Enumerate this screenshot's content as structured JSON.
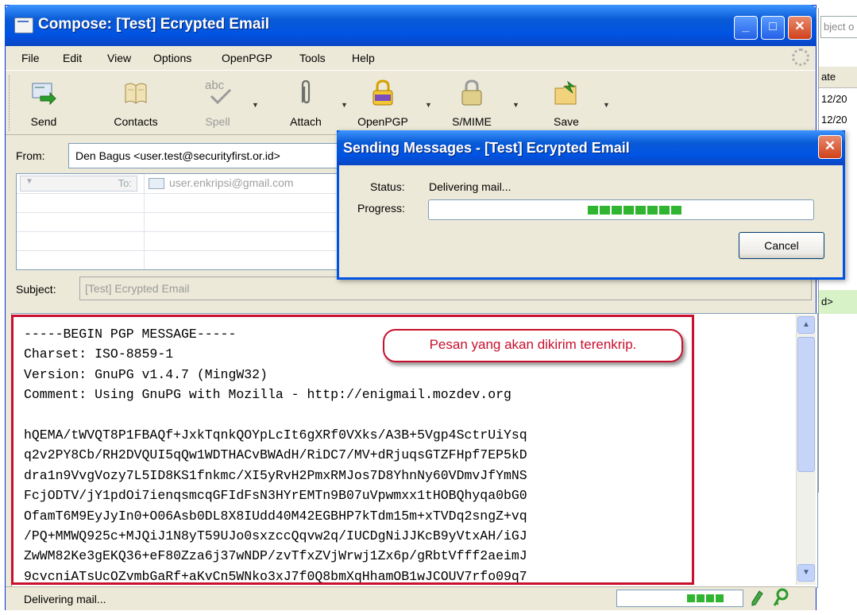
{
  "background_window": {
    "search_placeholder": "bject o",
    "column_header": "ate",
    "rows": [
      "12/20",
      "12/20"
    ],
    "highlight_row_text": "d>"
  },
  "window": {
    "title": "Compose: [Test] Ecrypted Email",
    "minimize_glyph": "_",
    "maximize_glyph": "□",
    "close_glyph": "✕"
  },
  "menu": [
    "File",
    "Edit",
    "View",
    "Options",
    "OpenPGP",
    "Tools",
    "Help"
  ],
  "toolbar": {
    "send": "Send",
    "contacts": "Contacts",
    "spell": "Spell",
    "attach": "Attach",
    "openpgp": "OpenPGP",
    "smime": "S/MIME",
    "save": "Save",
    "spell_icon_text": "abc"
  },
  "compose": {
    "from_label": "From:",
    "from_value": "Den Bagus <user.test@securityfirst.or.id>",
    "to_label": "To:",
    "to_value": "user.enkripsi@gmail.com",
    "subject_label": "Subject:",
    "subject_value": "[Test] Ecrypted Email"
  },
  "body": {
    "lines": [
      "-----BEGIN PGP MESSAGE-----",
      "Charset: ISO-8859-1",
      "Version: GnuPG v1.4.7 (MingW32)",
      "Comment: Using GnuPG with Mozilla - http://enigmail.mozdev.org",
      "",
      "hQEMA/tWVQT8P1FBAQf+JxkTqnkQOYpLcIt6gXRf0VXks/A3B+5Vgp4SctrUiYsq",
      "q2v2PY8Cb/RH2DVQUI5qQw1WDTHACvBWAdH/RiDC7/MV+dRjuqsGTZFHpf7EP5kD",
      "dra1n9VvgVozy7L5ID8KS1fnkmc/XI5yRvH2PmxRMJos7D8YhnNy60VDmvJfYmNS",
      "FcjODTV/jY1pdOi7ienqsmcqGFIdFsN3HYrEMTn9B07uVpwmxx1tHOBQhyqa0bG0",
      "OfamT6M9EyJyIn0+O06Asb0DL8X8IUdd40M42EGBHP7kTdm15m+xTVDq2sngZ+vq",
      "/PQ+MMWQ925c+MJQiJ1N8yT59UJo0sxzccQqvw2q/IUCDgNiJJKcB9yVtxAH/iGJ",
      "ZwWM82Ke3gEKQ36+eF80Zza6j37wNDP/zvTfxZVjWrwj1Zx6p/gRbtVfff2aeimJ",
      "9cvcniATsUcOZvmbGaRf+aKvCn5WNko3xJ7f0Q8bmXqHhamOB1wJCOUV7rfo09q7"
    ],
    "callout": "Pesan yang akan dikirim terenkrip."
  },
  "status_bar": {
    "text": "Delivering mail...",
    "progress_fraction": 0.3
  },
  "dialog": {
    "title": "Sending Messages - [Test] Ecrypted Email",
    "close_glyph": "✕",
    "status_label": "Status:",
    "status_value": "Delivering mail...",
    "progress_label": "Progress:",
    "progress_fraction": 0.25,
    "cancel_label": "Cancel"
  },
  "colors": {
    "titlebar_blue": "#0054e3",
    "annotation_red": "#c8102e",
    "progress_green": "#2fb52f",
    "window_bg": "#ece9d8"
  }
}
